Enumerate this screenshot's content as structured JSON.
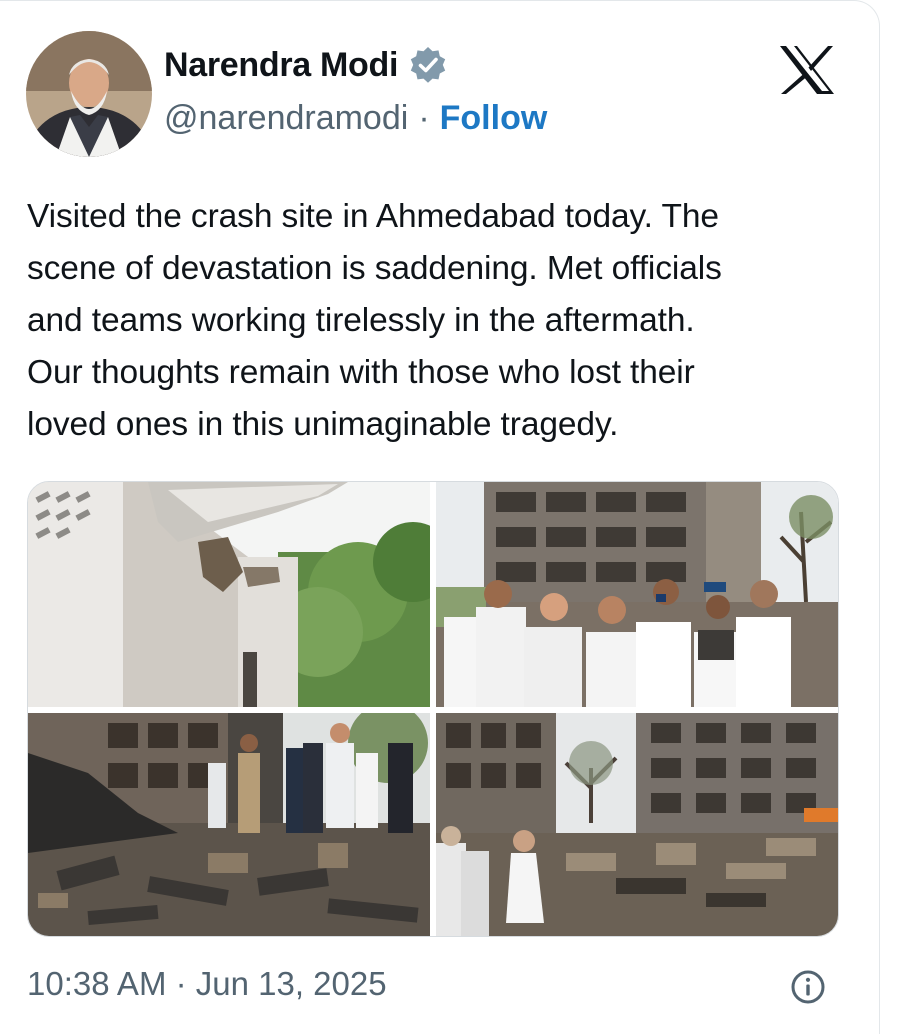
{
  "author": {
    "name": "Narendra Modi",
    "handle": "@narendramodi",
    "separator": "·",
    "follow_label": "Follow",
    "avatar_icon": "profile-photo",
    "verified_icon": "verified-badge-icon"
  },
  "platform": {
    "logo_icon": "x-logo-icon"
  },
  "tweet": {
    "lines": [
      "Visited the crash site in Ahmedabad today. The",
      "scene of devastation is saddening. Met officials",
      "and teams working tirelessly in the aftermath.",
      "Our thoughts remain with those who lost their",
      "loved ones in this unimaginable tragedy."
    ]
  },
  "media": {
    "count": 4
  },
  "footer": {
    "timestamp": "10:38 AM · Jun 13, 2025",
    "info_icon": "info-icon"
  },
  "colors": {
    "accent": "#1d78c4",
    "muted": "#536471",
    "text": "#0f1419",
    "verified": "#829aab"
  }
}
